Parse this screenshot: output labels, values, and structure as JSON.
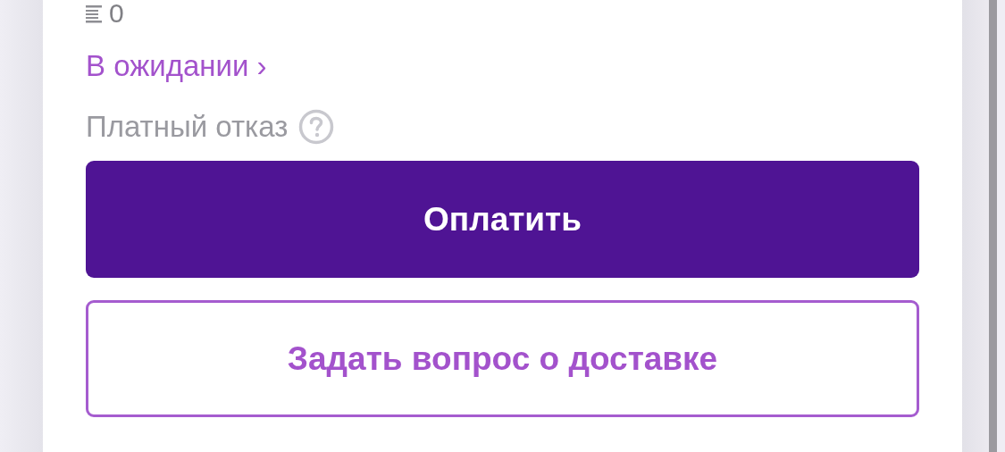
{
  "quantity": "0",
  "status_link": "В ожидании ›",
  "paid_refusal": "Платный отказ",
  "buttons": [
    {
      "kind": "primary",
      "label": "Оплатить"
    },
    {
      "kind": "outline",
      "label": "Задать вопрос о доставке"
    }
  ]
}
